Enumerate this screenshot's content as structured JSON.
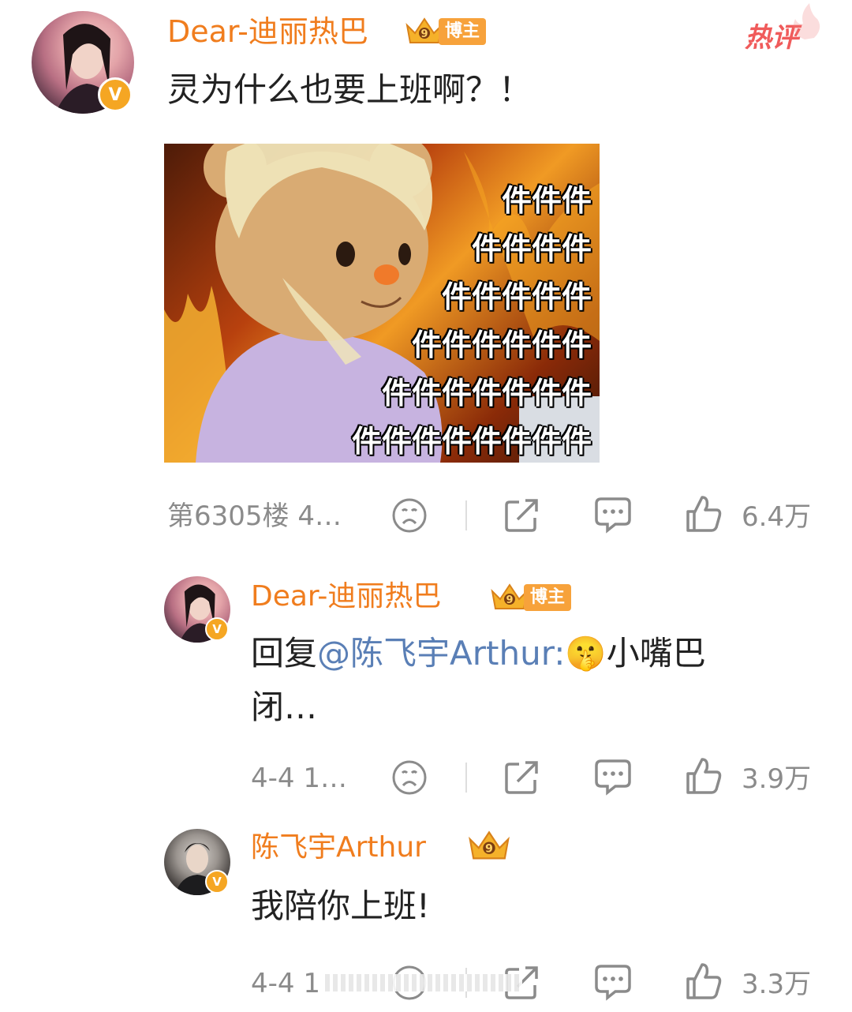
{
  "hot_label": "热评",
  "comment": {
    "username": "Dear-迪丽热巴",
    "badge_label": "博主",
    "crown_level": "9",
    "verified_mark": "V",
    "text": "灵为什么也要上班啊？！",
    "image": {
      "lines": [
        "件件件",
        "件件件件",
        "件件件件件",
        "件件件件件件",
        "件件件件件件件",
        "件件件件件件件件"
      ]
    },
    "meta": "第6305楼 4…",
    "like_count": "6.4万"
  },
  "replies": [
    {
      "username": "Dear-迪丽热巴",
      "badge_label": "博主",
      "crown_level": "9",
      "verified_mark": "V",
      "text_prefix": "回复",
      "mention": "@陈飞宇Arthur:",
      "emoji": "🤫",
      "text_line1_rest": "小嘴巴",
      "text_line2": "闭…",
      "meta": "4-4 1…",
      "like_count": "3.9万"
    },
    {
      "username": "陈飞宇Arthur",
      "crown_level": "9",
      "verified_mark": "V",
      "text": "我陪你上班!",
      "meta": "4-4 1",
      "like_count": "3.3万"
    }
  ],
  "colors": {
    "username": "#f07d1e",
    "mention": "#5a7fb6",
    "meta": "#8b8b8b",
    "verified": "#f5a623",
    "hot": "#f05b5b"
  }
}
